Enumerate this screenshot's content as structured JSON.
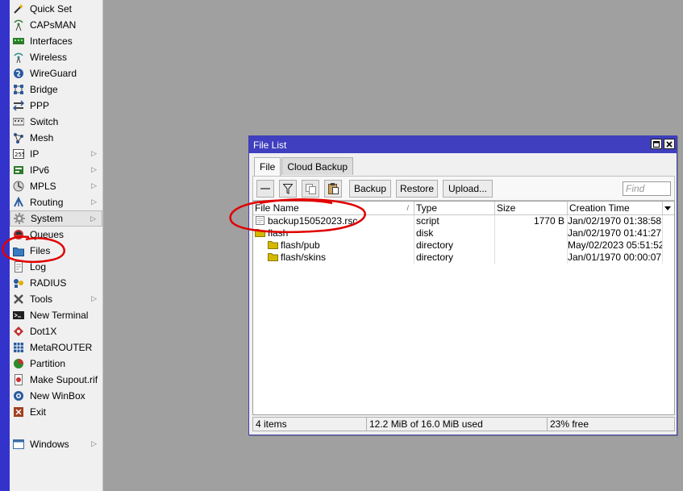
{
  "menu": {
    "items": [
      {
        "label": "Quick Set",
        "icon": "wand-icon",
        "submenu": false
      },
      {
        "label": "CAPsMAN",
        "icon": "antenna-icon",
        "submenu": false
      },
      {
        "label": "Interfaces",
        "icon": "interfaces-icon",
        "submenu": false
      },
      {
        "label": "Wireless",
        "icon": "wireless-icon",
        "submenu": false
      },
      {
        "label": "WireGuard",
        "icon": "wireguard-icon",
        "submenu": false
      },
      {
        "label": "Bridge",
        "icon": "bridge-icon",
        "submenu": false
      },
      {
        "label": "PPP",
        "icon": "ppp-icon",
        "submenu": false
      },
      {
        "label": "Switch",
        "icon": "switch-icon",
        "submenu": false
      },
      {
        "label": "Mesh",
        "icon": "mesh-icon",
        "submenu": false
      },
      {
        "label": "IP",
        "icon": "ip-icon",
        "submenu": true
      },
      {
        "label": "IPv6",
        "icon": "ipv6-icon",
        "submenu": true
      },
      {
        "label": "MPLS",
        "icon": "mpls-icon",
        "submenu": true
      },
      {
        "label": "Routing",
        "icon": "routing-icon",
        "submenu": true
      },
      {
        "label": "System",
        "icon": "gear-icon",
        "submenu": true
      },
      {
        "label": "Queues",
        "icon": "queues-icon",
        "submenu": false
      },
      {
        "label": "Files",
        "icon": "folder-icon",
        "submenu": false
      },
      {
        "label": "Log",
        "icon": "log-icon",
        "submenu": false
      },
      {
        "label": "RADIUS",
        "icon": "radius-icon",
        "submenu": false
      },
      {
        "label": "Tools",
        "icon": "tools-icon",
        "submenu": true
      },
      {
        "label": "New Terminal",
        "icon": "terminal-icon",
        "submenu": false
      },
      {
        "label": "Dot1X",
        "icon": "dot1x-icon",
        "submenu": false
      },
      {
        "label": "MetaROUTER",
        "icon": "metarouter-icon",
        "submenu": false
      },
      {
        "label": "Partition",
        "icon": "partition-icon",
        "submenu": false
      },
      {
        "label": "Make Supout.rif",
        "icon": "supout-icon",
        "submenu": false
      },
      {
        "label": "New WinBox",
        "icon": "winbox-icon",
        "submenu": false
      },
      {
        "label": "Exit",
        "icon": "exit-icon",
        "submenu": false
      }
    ],
    "windows_label": "Windows"
  },
  "window": {
    "title": "File List",
    "tabs": [
      "File",
      "Cloud Backup"
    ],
    "toolbar": {
      "backup": "Backup",
      "restore": "Restore",
      "upload": "Upload...",
      "find_placeholder": "Find"
    },
    "columns": [
      "File Name",
      "Type",
      "Size",
      "Creation Time"
    ],
    "rows": [
      {
        "name": "backup15052023.rsc",
        "type": "script",
        "size": "1770 B",
        "created": "Jan/02/1970 01:38:58",
        "icon": "file-icon"
      },
      {
        "name": "flash",
        "type": "disk",
        "size": "",
        "created": "Jan/02/1970 01:41:27",
        "icon": "folder-icon"
      },
      {
        "name": "flash/pub",
        "type": "directory",
        "size": "",
        "created": "May/02/2023 05:51:52",
        "icon": "folder-icon"
      },
      {
        "name": "flash/skins",
        "type": "directory",
        "size": "",
        "created": "Jan/01/1970 00:00:07",
        "icon": "folder-icon"
      }
    ],
    "status": {
      "items": "4 items",
      "used": "12.2 MiB of 16.0 MiB used",
      "free": "23% free"
    }
  },
  "colors": {
    "title_bar": "#3f3fbf",
    "side_bar": "#3333cc",
    "desktop": "#a0a0a0",
    "annotation": "#e00000",
    "folder": "#d4b800"
  }
}
